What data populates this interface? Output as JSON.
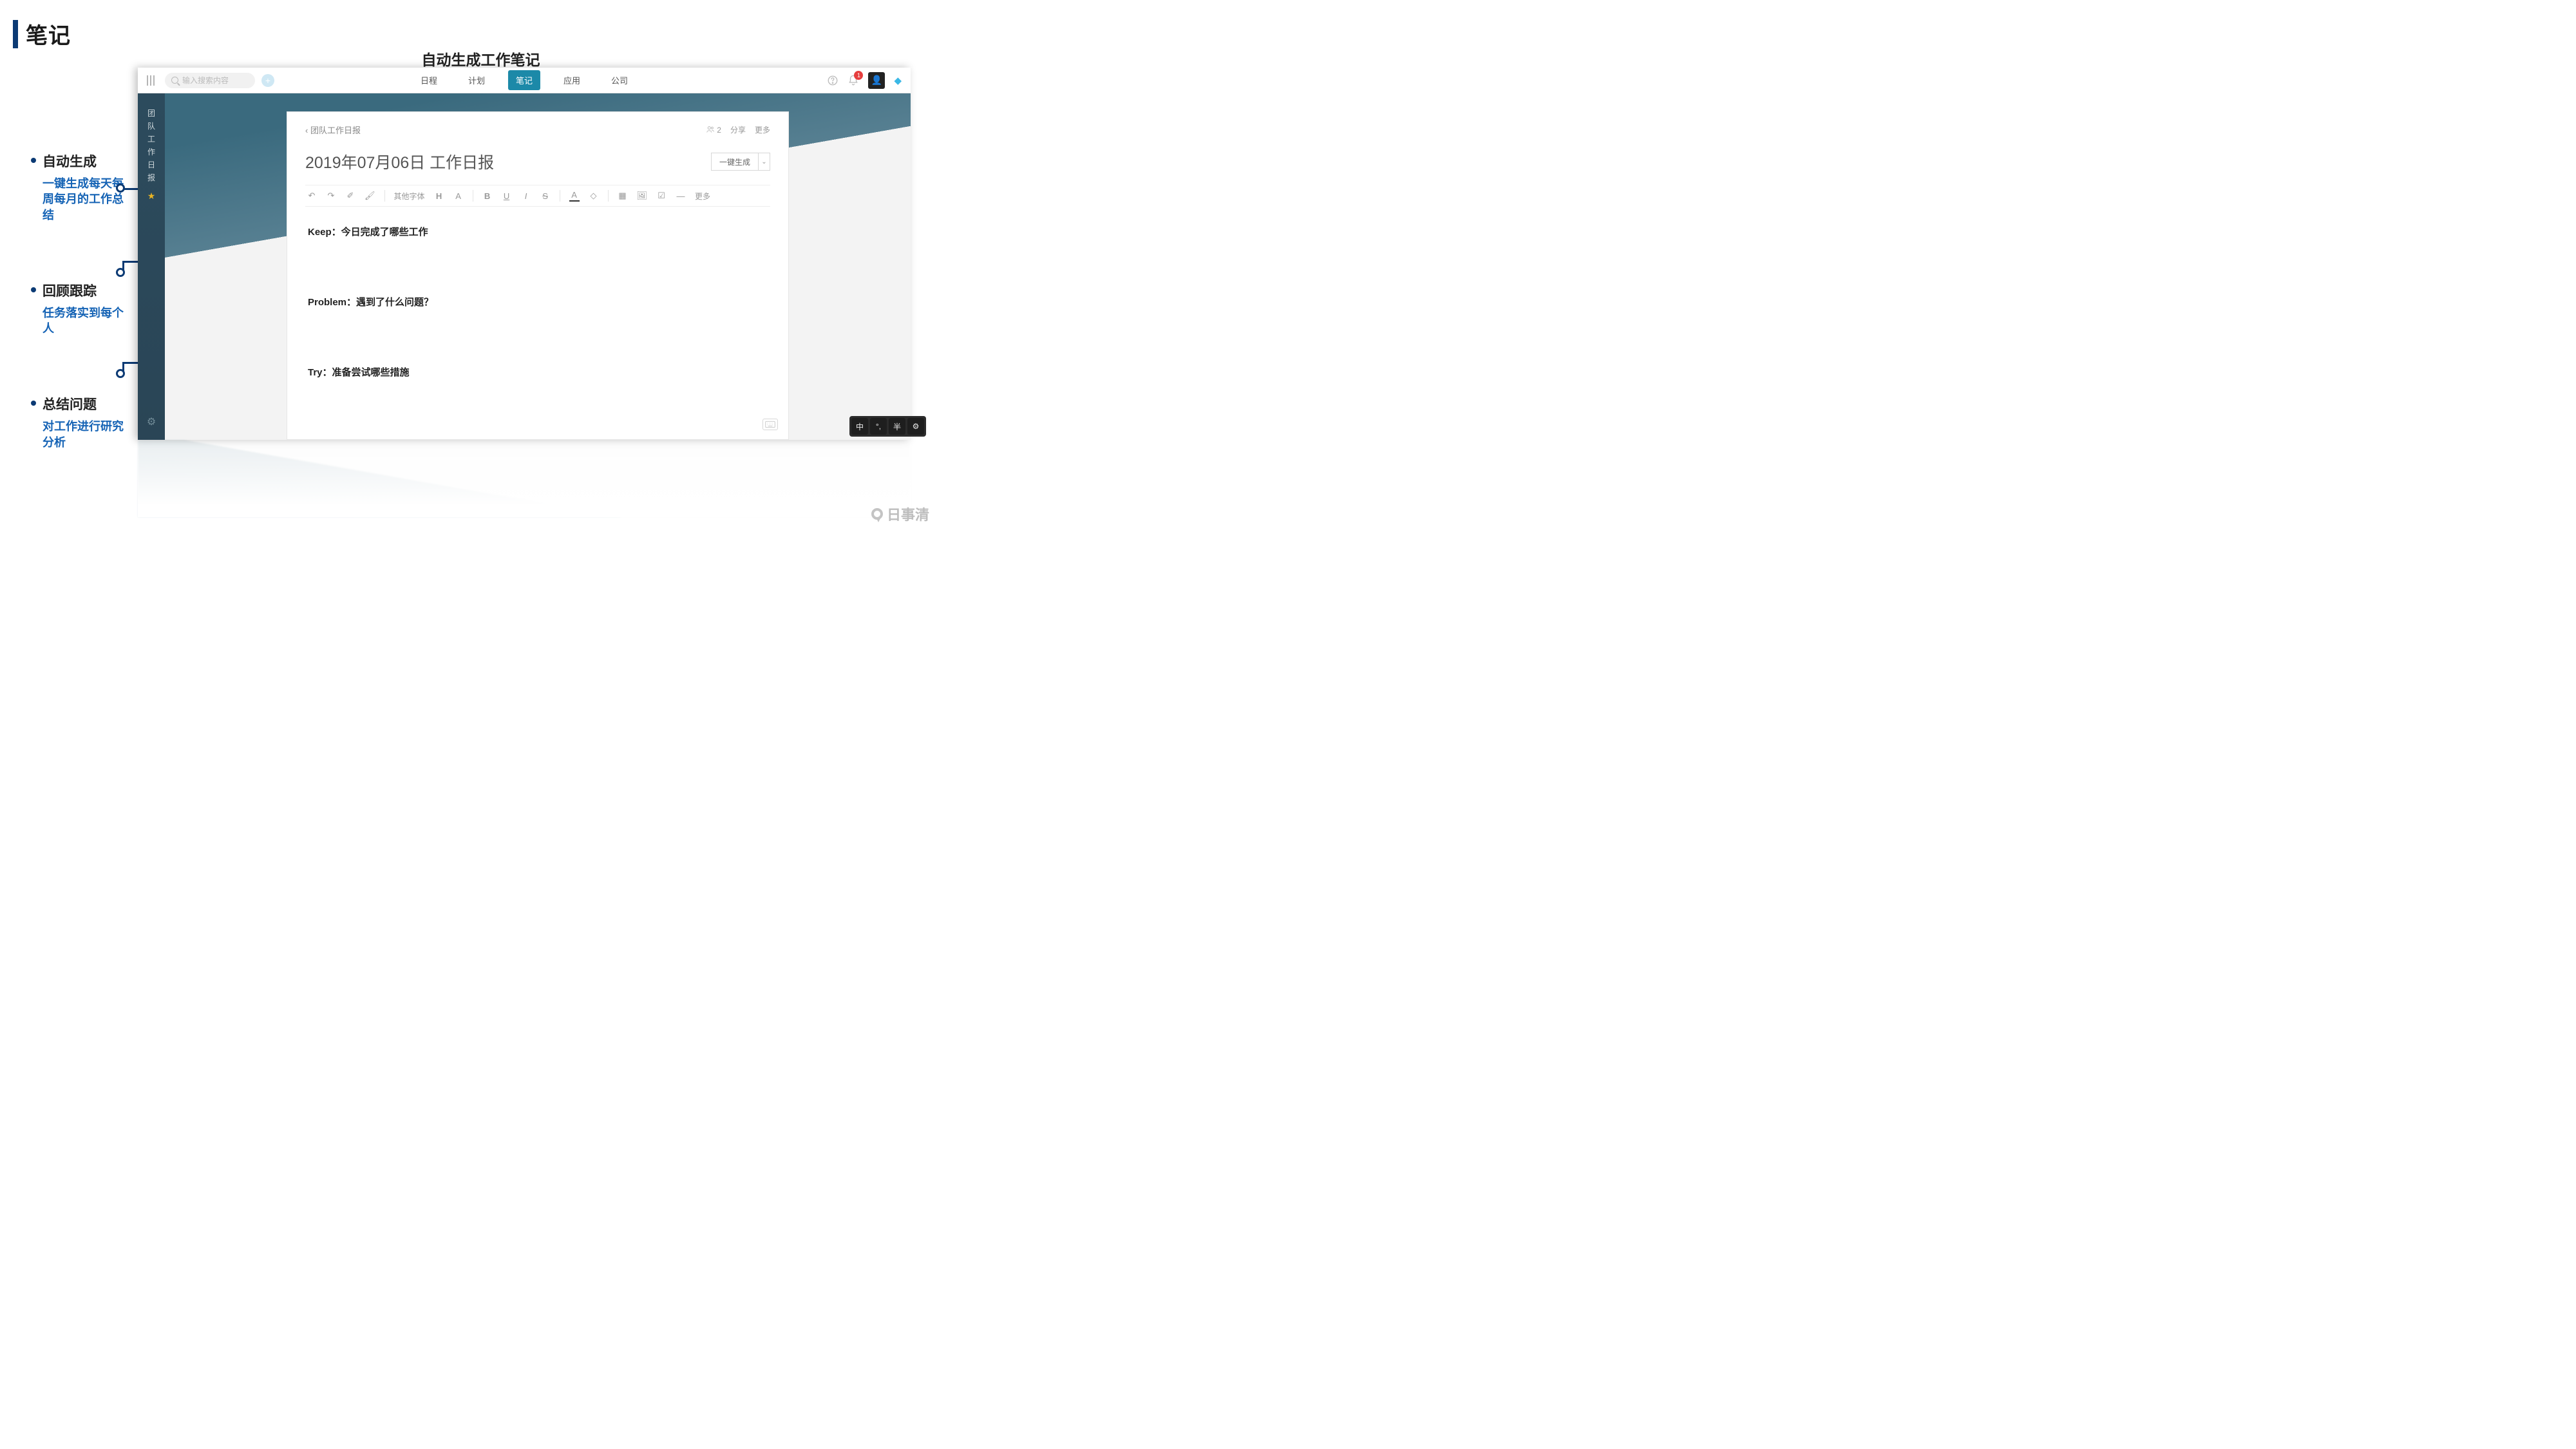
{
  "slide": {
    "title": "笔记",
    "heading": "自动生成工作笔记"
  },
  "annotations": [
    {
      "title": "自动生成",
      "sub": "一键生成每天每周每月的工作总结"
    },
    {
      "title": "回顾跟踪",
      "sub": "任务落实到每个人"
    },
    {
      "title": "总结问题",
      "sub": "对工作进行研究分析"
    }
  ],
  "shot": {
    "search_placeholder": "输入搜索内容",
    "nav_tabs": [
      "日程",
      "计划",
      "笔记",
      "应用",
      "公司"
    ],
    "nav_active_index": 2,
    "notif_count": "1",
    "leftrail_title_chars": [
      "团",
      "队",
      "工",
      "作",
      "日",
      "报"
    ],
    "doc": {
      "crumb": "团队工作日报",
      "share_label": "分享",
      "more_label": "更多",
      "members_count": "2",
      "title": "2019年07月06日 工作日报",
      "gen_button": "一键生成",
      "font_label": "其他字体",
      "tb_more": "更多",
      "lines": [
        "Keep：今日完成了哪些工作",
        "Problem：遇到了什么问题？",
        "Try：准备尝试哪些措施"
      ]
    }
  },
  "ime": {
    "keys": [
      "中",
      "°,",
      "半",
      "⚙"
    ]
  },
  "brand": "日事清"
}
